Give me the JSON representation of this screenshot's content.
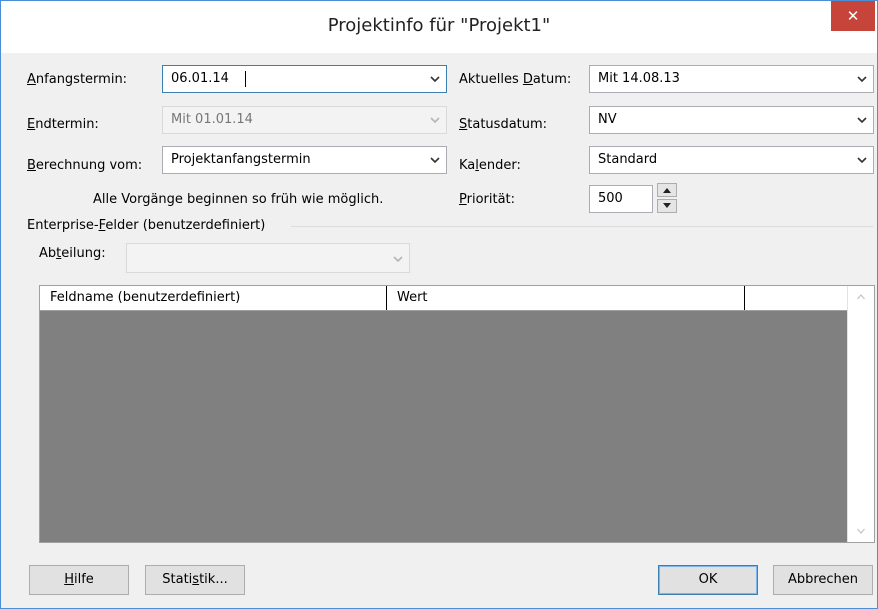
{
  "dialog": {
    "title": "Projektinfo für \"Projekt1\"",
    "close_label": "✕"
  },
  "left": {
    "start_label_u": "A",
    "start_label_rest": "nfangstermin:",
    "start_value": "06.01.14",
    "end_label_u": "E",
    "end_label_rest": "ndtermin:",
    "end_value": "Mit 01.01.14",
    "calc_label_u": "B",
    "calc_label_rest": "erechnung vom:",
    "calc_value": "Projektanfangstermin",
    "info_text": "Alle Vorgänge beginnen so früh wie möglich."
  },
  "right": {
    "current_label_pre": "Aktuelles ",
    "current_label_u": "D",
    "current_label_rest": "atum:",
    "current_value": "Mit 14.08.13",
    "status_label_u": "S",
    "status_label_rest": "tatusdatum:",
    "status_value": "NV",
    "calendar_label_pre": "Ka",
    "calendar_label_u": "l",
    "calendar_label_rest": "ender:",
    "calendar_value": "Standard",
    "priority_label_u": "P",
    "priority_label_rest": "riorität:",
    "priority_value": "500"
  },
  "enterprise": {
    "group_label_pre": "Enterprise-",
    "group_label_u": "F",
    "group_label_rest": "elder (benutzerdefiniert)",
    "dept_label_pre": "Ab",
    "dept_label_u": "t",
    "dept_label_rest": "eilung:",
    "dept_value": "",
    "columns": [
      "Feldname (benutzerdefiniert)",
      "Wert"
    ]
  },
  "buttons": {
    "help_u": "H",
    "help_rest": "ilfe",
    "stats_pre": "Stati",
    "stats_u": "s",
    "stats_rest": "tik...",
    "ok": "OK",
    "cancel": "Abbrechen"
  }
}
